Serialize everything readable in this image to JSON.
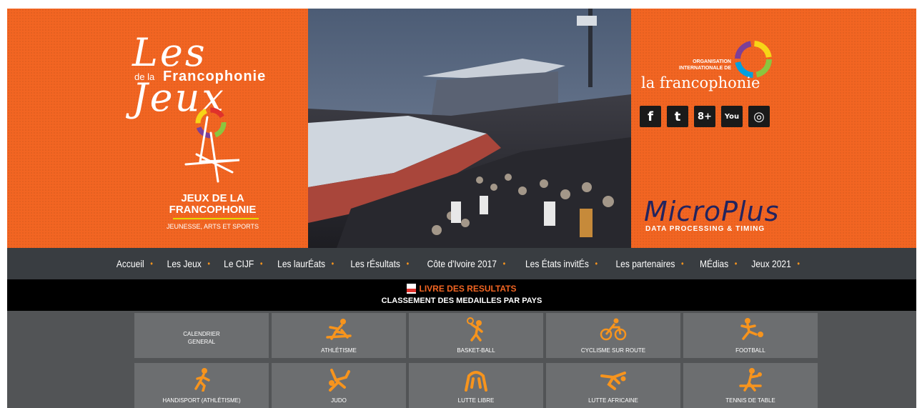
{
  "banner": {
    "title_script": "Les Jeux",
    "title_prefix": "de la",
    "title_brand": "Francophonie",
    "games_name": "JEUX DE LA FRANCOPHONIE",
    "games_tagline": "JEUNESSE, ARTS ET SPORTS",
    "oif_small": "ORGANISATION INTERNATIONALE DE",
    "oif_name": "la francophonie",
    "sponsor_name": "MicroPlus",
    "sponsor_tagline": "DATA PROCESSING & TIMING",
    "social": [
      {
        "icon": "facebook-icon",
        "glyph": "f"
      },
      {
        "icon": "twitter-icon",
        "glyph": "t"
      },
      {
        "icon": "googleplus-icon",
        "glyph": "8+"
      },
      {
        "icon": "youtube-icon",
        "glyph": "You"
      },
      {
        "icon": "instagram-icon",
        "glyph": "◎"
      }
    ],
    "colors": {
      "orange": "#f26522",
      "navy": "#23245e"
    }
  },
  "nav": {
    "items": [
      "Accueil",
      "Les Jeux",
      "Le CIJF",
      "Les laurÉats",
      "Les rÉsultats",
      "Côte d'Ivoire 2017",
      "Les États invitÉs",
      "Les partenaires",
      "MÉdias",
      "Jeux 2021"
    ],
    "separator": "•"
  },
  "results": {
    "livre": "LIVRE DES RESULTATS",
    "classement": "CLASSEMENT DES MEDAILLES PAR PAYS"
  },
  "tiles": [
    {
      "label": "CALENDRIER GENERAL",
      "icon": "calendar"
    },
    {
      "label": "ATHLÉTISME",
      "icon": "athletics-icon"
    },
    {
      "label": "BASKET-BALL",
      "icon": "basketball-icon"
    },
    {
      "label": "CYCLISME SUR ROUTE",
      "icon": "cycling-icon"
    },
    {
      "label": "FOOTBALL",
      "icon": "football-icon"
    },
    {
      "label": "HANDISPORT (ATHLÉTISME)",
      "icon": "handisport-icon"
    },
    {
      "label": "JUDO",
      "icon": "judo-icon"
    },
    {
      "label": "LUTTE LIBRE",
      "icon": "freestyle-wrestling-icon"
    },
    {
      "label": "LUTTE AFRICAINE",
      "icon": "african-wrestling-icon"
    },
    {
      "label": "TENNIS DE TABLE",
      "icon": "table-tennis-icon"
    }
  ]
}
